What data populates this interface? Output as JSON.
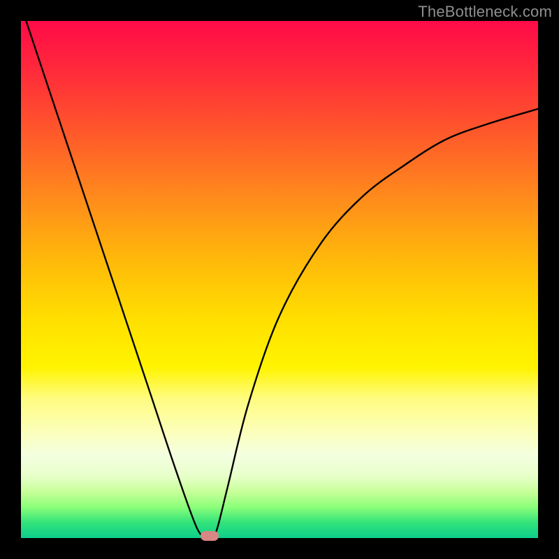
{
  "watermark": "TheBottleneck.com",
  "chart_data": {
    "type": "line",
    "title": "",
    "xlabel": "",
    "ylabel": "",
    "xlim": [
      0,
      100
    ],
    "ylim": [
      0,
      100
    ],
    "series": [
      {
        "name": "bottleneck-curve",
        "x": [
          0,
          5,
          10,
          15,
          20,
          25,
          30,
          34,
          36,
          37,
          38,
          40,
          44,
          50,
          58,
          66,
          74,
          82,
          90,
          100
        ],
        "values": [
          103,
          88,
          73,
          58,
          43,
          28,
          13,
          2,
          0,
          0,
          2,
          10,
          26,
          43,
          57,
          66,
          72,
          77,
          80,
          83
        ]
      }
    ],
    "legend": false,
    "grid": false,
    "marker": {
      "x": 36.5,
      "y": 0,
      "color": "#d88784"
    },
    "background_gradient": [
      "#ff0b48",
      "#ff2b3a",
      "#ff5a2a",
      "#ff8a1c",
      "#ffb80a",
      "#ffe000",
      "#fff400",
      "#fffc80",
      "#fbffbf",
      "#f3ffe0",
      "#e8ffca",
      "#c8ff9a",
      "#8cff7a",
      "#33e37a",
      "#0ccf8b"
    ]
  }
}
